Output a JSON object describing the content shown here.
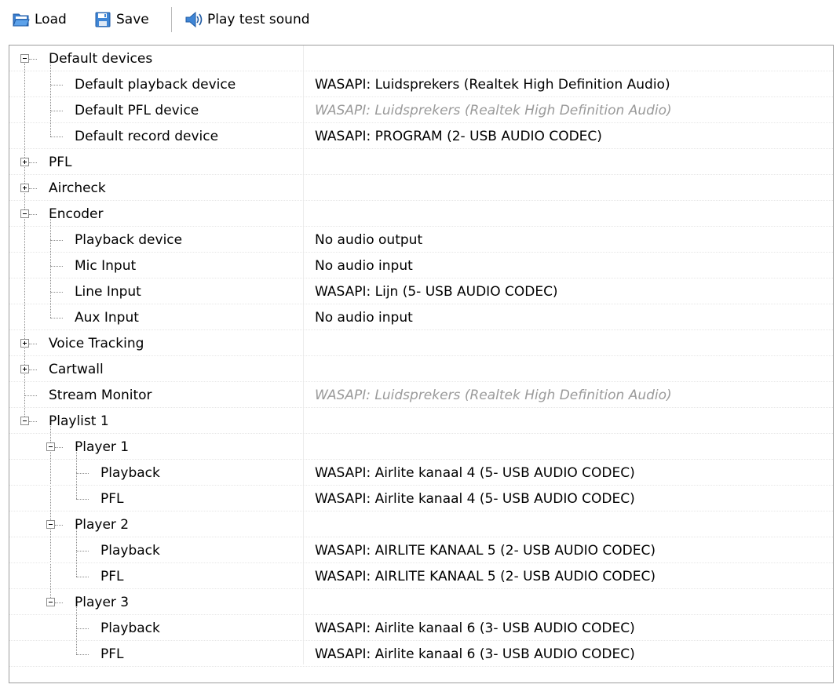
{
  "toolbar": {
    "load_label": "Load",
    "save_label": "Save",
    "play_label": "Play test sound"
  },
  "tree": {
    "rows": [
      {
        "label": "Default devices",
        "value": "",
        "level": 0,
        "expander": "minus"
      },
      {
        "label": "Default playback device",
        "value": "WASAPI: Luidsprekers (Realtek High Definition Audio)",
        "level": 1
      },
      {
        "label": "Default PFL device",
        "value": "WASAPI: Luidsprekers (Realtek High Definition Audio)",
        "level": 1,
        "ghost": true
      },
      {
        "label": "Default record device",
        "value": "WASAPI: PROGRAM (2- USB AUDIO  CODEC)",
        "level": 1
      },
      {
        "label": "PFL",
        "value": "",
        "level": 0,
        "expander": "plus"
      },
      {
        "label": "Aircheck",
        "value": "",
        "level": 0,
        "expander": "plus"
      },
      {
        "label": "Encoder",
        "value": "",
        "level": 0,
        "expander": "minus"
      },
      {
        "label": "Playback device",
        "value": "No audio output",
        "level": 1
      },
      {
        "label": "Mic Input",
        "value": "No audio input",
        "level": 1
      },
      {
        "label": "Line Input",
        "value": "WASAPI: Lijn (5- USB AUDIO  CODEC)",
        "level": 1
      },
      {
        "label": "Aux Input",
        "value": "No audio input",
        "level": 1
      },
      {
        "label": "Voice Tracking",
        "value": "",
        "level": 0,
        "expander": "plus"
      },
      {
        "label": "Cartwall",
        "value": "",
        "level": 0,
        "expander": "plus"
      },
      {
        "label": "Stream Monitor",
        "value": "WASAPI: Luidsprekers (Realtek High Definition Audio)",
        "level": 0,
        "ghost": true
      },
      {
        "label": "Playlist 1",
        "value": "",
        "level": 0,
        "expander": "minus"
      },
      {
        "label": "Player 1",
        "value": "",
        "level": 1,
        "expander": "minus"
      },
      {
        "label": "Playback",
        "value": "WASAPI: Airlite kanaal 4 (5- USB AUDIO  CODEC)",
        "level": 2
      },
      {
        "label": "PFL",
        "value": "WASAPI: Airlite kanaal 4 (5- USB AUDIO  CODEC)",
        "level": 2
      },
      {
        "label": "Player 2",
        "value": "",
        "level": 1,
        "expander": "minus"
      },
      {
        "label": "Playback",
        "value": "WASAPI: AIRLITE KANAAL 5 (2- USB AUDIO  CODEC)",
        "level": 2
      },
      {
        "label": "PFL",
        "value": "WASAPI: AIRLITE KANAAL 5 (2- USB AUDIO  CODEC)",
        "level": 2
      },
      {
        "label": "Player 3",
        "value": "",
        "level": 1,
        "expander": "minus"
      },
      {
        "label": "Playback",
        "value": "WASAPI: Airlite kanaal 6 (3- USB AUDIO  CODEC)",
        "level": 2
      },
      {
        "label": "PFL",
        "value": "WASAPI: Airlite kanaal 6 (3- USB AUDIO  CODEC)",
        "level": 2
      }
    ]
  }
}
